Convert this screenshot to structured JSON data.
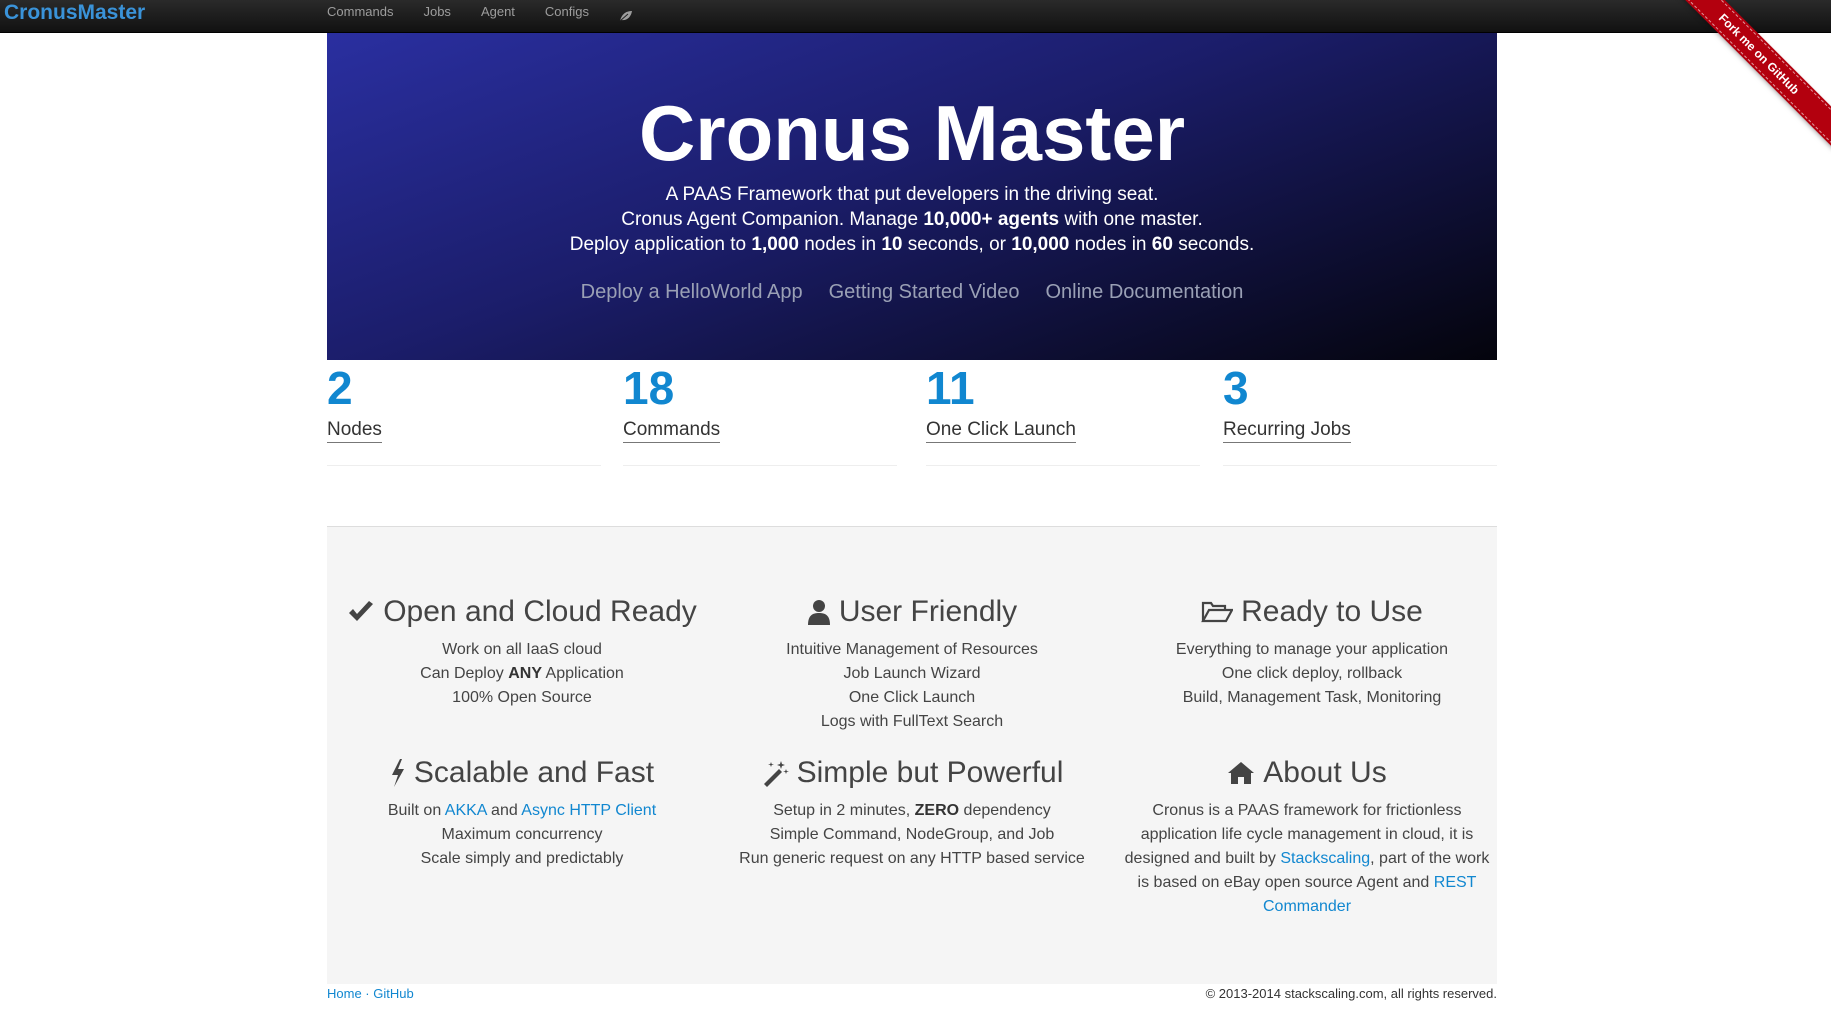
{
  "navbar": {
    "brand": "CronusMaster",
    "items": [
      "Commands",
      "Jobs",
      "Agent",
      "Configs"
    ]
  },
  "ribbon": {
    "label": "Fork me on GitHub"
  },
  "hero": {
    "title": "Cronus Master",
    "line1": "A PAAS Framework that put developers in the driving seat.",
    "line2_pre": "Cronus Agent Companion. Manage ",
    "line2_bold": "10,000+ agents",
    "line2_post": " with one master.",
    "line3_a": "Deploy application to ",
    "line3_b": "1,000",
    "line3_c": " nodes in ",
    "line3_d": "10",
    "line3_e": " seconds, or ",
    "line3_f": "10,000",
    "line3_g": " nodes in ",
    "line3_h": "60",
    "line3_i": " seconds.",
    "links": [
      "Deploy a HelloWorld App",
      "Getting Started Video",
      "Online Documentation"
    ]
  },
  "stats": [
    {
      "value": "2",
      "label": "Nodes"
    },
    {
      "value": "18",
      "label": "Commands"
    },
    {
      "value": "11",
      "label": "One Click Launch"
    },
    {
      "value": "3",
      "label": "Recurring Jobs"
    }
  ],
  "features": {
    "open": {
      "title": "Open and Cloud Ready",
      "l1": "Work on all IaaS cloud",
      "l2_pre": "Can Deploy ",
      "l2_bold": "ANY",
      "l2_post": " Application",
      "l3": "100% Open Source"
    },
    "user": {
      "title": "User Friendly",
      "l1": "Intuitive Management of Resources",
      "l2": "Job Launch Wizard",
      "l3": "One Click Launch",
      "l4": "Logs with FullText Search"
    },
    "ready": {
      "title": "Ready to Use",
      "l1": "Everything to manage your application",
      "l2": "One click deploy, rollback",
      "l3": "Build, Management Task, Monitoring"
    },
    "scalable": {
      "title": "Scalable and Fast",
      "l1_pre": "Built on ",
      "l1_link1": "AKKA",
      "l1_mid": " and ",
      "l1_link2": "Async HTTP Client",
      "l2": "Maximum concurrency",
      "l3": "Scale simply and predictably"
    },
    "simple": {
      "title": "Simple but Powerful",
      "l1_pre": "Setup in 2 minutes, ",
      "l1_bold": "ZERO",
      "l1_post": " dependency",
      "l2": "Simple Command, NodeGroup, and Job",
      "l3": "Run generic request on any HTTP based service"
    },
    "about": {
      "title": "About Us",
      "p1": "Cronus is a PAAS framework for frictionless application life cycle management in cloud, it is designed and built by ",
      "link1": "Stackscaling",
      "p2": ", part of the work is based on eBay open source Agent and ",
      "link2": "REST Commander"
    }
  },
  "footer": {
    "home": "Home",
    "sep": " · ",
    "github": "GitHub",
    "copyright": "© 2013-2014 stackscaling.com, all rights reserved."
  }
}
